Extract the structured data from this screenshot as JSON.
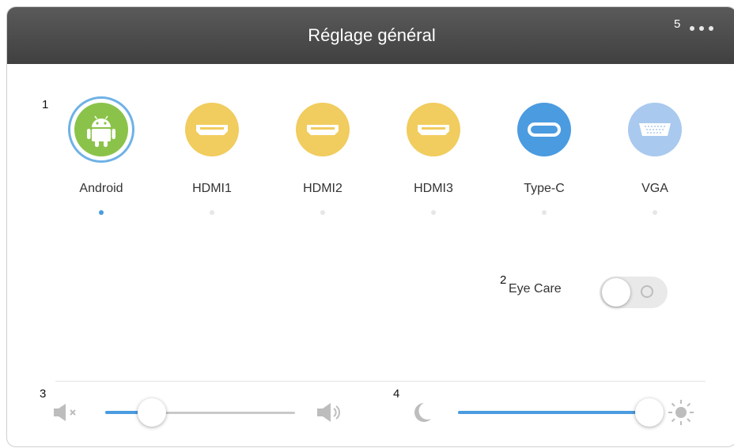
{
  "header": {
    "title": "Réglage général",
    "more_icon": "more-dots-icon"
  },
  "markers": {
    "m1": "1",
    "m2": "2",
    "m3": "3",
    "m4": "4",
    "m5": "5"
  },
  "sources": [
    {
      "label": "Android",
      "icon": "android-icon",
      "color": "#8bc34a",
      "active": true
    },
    {
      "label": "HDMI1",
      "icon": "hdmi-icon",
      "color": "#f1cc5e",
      "active": false
    },
    {
      "label": "HDMI2",
      "icon": "hdmi-icon",
      "color": "#f1cc5e",
      "active": false
    },
    {
      "label": "HDMI3",
      "icon": "hdmi-icon",
      "color": "#f1cc5e",
      "active": false
    },
    {
      "label": "Type-C",
      "icon": "usb-c-icon",
      "color": "#4b9be0",
      "active": false
    },
    {
      "label": "VGA",
      "icon": "vga-icon",
      "color": "#a9c9ef",
      "active": false
    }
  ],
  "eye_care": {
    "label": "Eye Care",
    "enabled": false
  },
  "volume": {
    "level": 0.2,
    "low_icon": "mute-icon",
    "high_icon": "speaker-high-icon"
  },
  "brightness": {
    "level": 1.0,
    "low_icon": "moon-icon",
    "high_icon": "sun-icon"
  },
  "colors": {
    "accent": "#4b9be0",
    "header_bg": "#4a4a4a"
  }
}
